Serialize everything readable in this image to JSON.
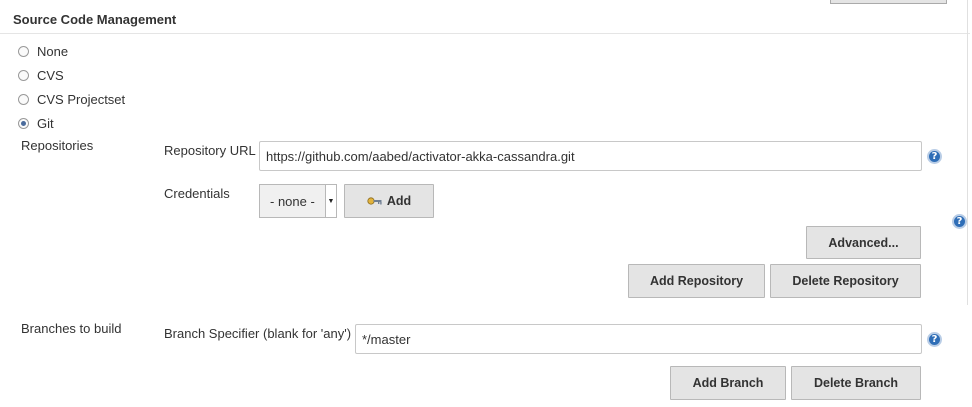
{
  "section": {
    "title": "Source Code Management"
  },
  "scm_options": [
    {
      "label": "None",
      "checked": false
    },
    {
      "label": "CVS",
      "checked": false
    },
    {
      "label": "CVS Projectset",
      "checked": false
    },
    {
      "label": "Git",
      "checked": true
    }
  ],
  "repositories": {
    "label": "Repositories",
    "url_label": "Repository URL",
    "url_value": "https://github.com/aabed/activator-akka-cassandra.git",
    "credentials_label": "Credentials",
    "credentials_selected": "- none -",
    "add_label": "Add",
    "advanced_label": "Advanced...",
    "add_repository_label": "Add Repository",
    "delete_repository_label": "Delete Repository"
  },
  "branches": {
    "label": "Branches to build",
    "specifier_label": "Branch Specifier (blank for 'any')",
    "specifier_value": "*/master",
    "add_branch_label": "Add Branch",
    "delete_branch_label": "Delete Branch"
  },
  "help_symbol": "?",
  "icons": {
    "help": "help-icon",
    "key": "key-icon",
    "dropdown": "chevron-down-icon"
  },
  "colors": {
    "help_blue": "#2f6eb7",
    "button_bg": "#e4e4e4"
  }
}
